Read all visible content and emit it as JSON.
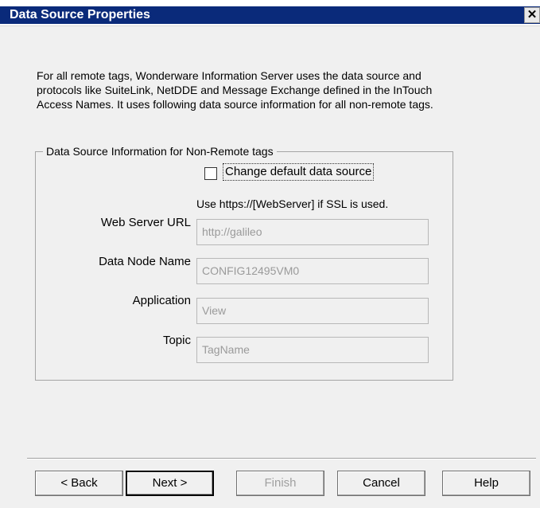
{
  "window": {
    "title": "Data Source Properties",
    "close_glyph": "✕"
  },
  "intro_text": "For all remote tags, Wonderware Information Server uses the data source and protocols like SuiteLink, NetDDE and Message Exchange defined in the InTouch Access Names. It uses following data source information for all non-remote tags.",
  "group": {
    "legend": "Data Source Information for Non-Remote tags",
    "checkbox_label": "Change default data source",
    "checkbox_checked": false,
    "ssl_note": "Use https://[WebServer] if SSL is used.",
    "fields": {
      "web_server_url": {
        "label": "Web Server URL",
        "value": "http://galileo"
      },
      "data_node_name": {
        "label": "Data Node Name",
        "value": "CONFIG12495VM0"
      },
      "application": {
        "label": "Application",
        "value": "View"
      },
      "topic": {
        "label": "Topic",
        "value": "TagName"
      }
    }
  },
  "buttons": {
    "back": "< Back",
    "next": "Next >",
    "finish": "Finish",
    "cancel": "Cancel",
    "help": "Help"
  },
  "colors": {
    "titlebar": "#0a2a7a",
    "dialog_bg": "#f0f0f0",
    "disabled_text": "#9a9a9a"
  }
}
